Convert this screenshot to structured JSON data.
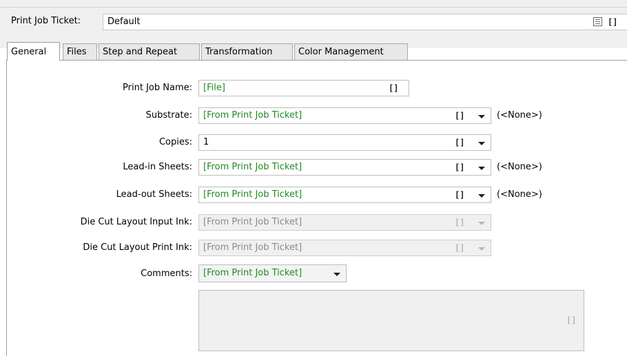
{
  "print_job_ticket": {
    "label": "Print Job Ticket:",
    "value": "Default",
    "list_icon": "list-icon",
    "brackets_icon": "[]"
  },
  "tabs": [
    {
      "label": "General",
      "active": true
    },
    {
      "label": "Files",
      "active": false
    },
    {
      "label": "Step and Repeat",
      "active": false
    },
    {
      "label": "Transformation",
      "active": false
    },
    {
      "label": "Color Management",
      "active": false
    }
  ],
  "form": {
    "print_job_name": {
      "label": "Print Job Name:",
      "value": "[File]"
    },
    "substrate": {
      "label": "Substrate:",
      "value": "[From Print Job Ticket]",
      "side": "(<None>)"
    },
    "copies": {
      "label": "Copies:",
      "value": "1"
    },
    "lead_in": {
      "label": "Lead-in Sheets:",
      "value": "[From Print Job Ticket]",
      "side": "(<None>)"
    },
    "lead_out": {
      "label": "Lead-out Sheets:",
      "value": "[From Print Job Ticket]",
      "side": "(<None>)"
    },
    "die_cut_input": {
      "label": "Die Cut Layout Input Ink:",
      "value": "[From Print Job Ticket]",
      "disabled": true
    },
    "die_cut_print": {
      "label": "Die Cut Layout Print Ink:",
      "value": "[From Print Job Ticket]",
      "disabled": true
    },
    "comments": {
      "label": "Comments:",
      "value": "[From Print Job Ticket]"
    }
  },
  "bracket_glyph": "[]",
  "colors": {
    "inherited_value_text": "#208a20",
    "disabled_text": "#8a8a8a",
    "window_background": "#f0f0f0"
  }
}
